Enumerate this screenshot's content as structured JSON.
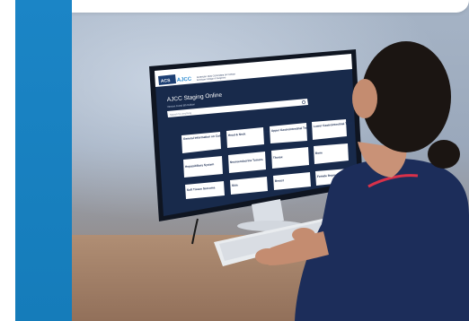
{
  "screen": {
    "logo_acs": "ACS",
    "logo_ajcc": "AJCC",
    "header_line1": "American Joint Committee on Cancer",
    "header_line2": "American College of Surgeons",
    "page_title": "AJCC Staging Online",
    "subtitle": "Version 9 and 8th Edition",
    "search_placeholder": "Search for anything"
  },
  "tiles": [
    "General Information on Cancer Staging and End Results Reporting",
    "Head & Neck",
    "Upper Gastrointestinal Tract",
    "Lower Gastrointestinal Tract",
    "Hepatobiliary System",
    "Neuroendocrine Tumors",
    "Thorax",
    "Bone",
    "Soft Tissue Sarcoma",
    "Skin",
    "Breast",
    "Female Reproductive Organs"
  ],
  "colors": {
    "blue_band": "#1b85c6",
    "screen_navy": "#182a4b",
    "ajcc_blue": "#2a8ad0"
  }
}
